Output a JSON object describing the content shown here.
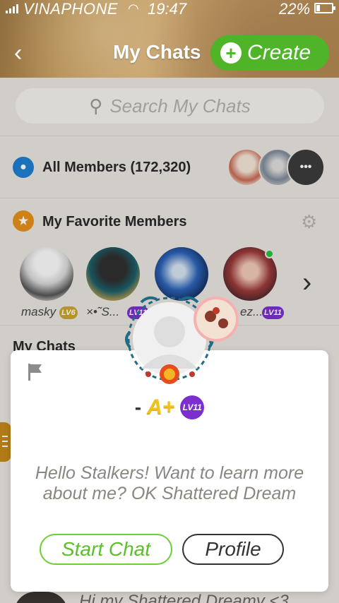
{
  "status_bar": {
    "carrier": "VINAPHONE",
    "time": "19:47",
    "battery": "22%"
  },
  "header": {
    "title": "My Chats",
    "create_label": "Create"
  },
  "search": {
    "placeholder": "Search My Chats"
  },
  "all_members": {
    "label": "All Members (172,320)",
    "more_label": "•••"
  },
  "favorites": {
    "title": "My Favorite Members",
    "members": [
      {
        "name": "masky",
        "level": "LV6"
      },
      {
        "name": "×•˜S...",
        "level": "LV11"
      },
      {
        "name": "",
        "level": ""
      },
      {
        "name": "ez...",
        "level": "LV11"
      }
    ]
  },
  "my_chats": {
    "title": "My Chats",
    "preview": "Hi my Shattered Dreamy <3"
  },
  "popup": {
    "name": "-",
    "plus_badge": "A+",
    "level": "LV11",
    "bio": "Hello Stalkers! Want to learn more about me? OK Shattered Dream",
    "start_chat_label": "Start Chat",
    "profile_label": "Profile"
  },
  "colors": {
    "create_green": "#4fb427",
    "start_chat_green": "#6ccf37",
    "level_purple": "#7b2fcf",
    "members_blue": "#1f7fd1",
    "favorites_orange": "#e7901c"
  }
}
